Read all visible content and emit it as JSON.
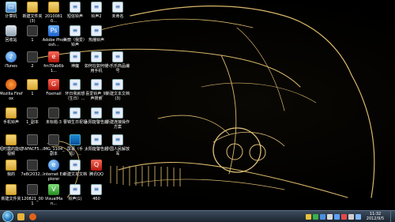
{
  "desktop": {
    "icons": [
      {
        "label": "计算机",
        "glyph": "g-computer",
        "sym": "▭"
      },
      {
        "label": "新建文件夹 (3)",
        "glyph": "g-folder",
        "sym": ""
      },
      {
        "label": "20100810...",
        "glyph": "g-folder",
        "sym": ""
      },
      {
        "label": "短信铃声",
        "glyph": "g-doc",
        "sym": "≡"
      },
      {
        "label": "铃声2",
        "glyph": "g-doc",
        "sym": "≡"
      },
      {
        "label": "未命名",
        "glyph": "g-doc",
        "sym": "≡"
      },
      {
        "label": "回收站",
        "glyph": "g-trash",
        "sym": ""
      },
      {
        "label": "1",
        "glyph": "g-dark",
        "sym": ""
      },
      {
        "label": "Adobe Photosh...",
        "glyph": "g-app",
        "sym": "Ps"
      },
      {
        "label": "美丽（我爱）铃声",
        "glyph": "g-doc",
        "sym": "≡"
      },
      {
        "label": "热播铃声",
        "glyph": "g-doc",
        "sym": "≡"
      },
      {
        "label": "iTunes",
        "glyph": "g-globe",
        "sym": "♪"
      },
      {
        "label": "2",
        "glyph": "g-dark",
        "sym": ""
      },
      {
        "label": "fm70ab6b1...",
        "glyph": "g-red",
        "sym": "e"
      },
      {
        "label": "神魔",
        "glyph": "g-doc",
        "sym": "≡"
      },
      {
        "label": "如何在如何使用手机",
        "glyph": "g-doc",
        "sym": "≡"
      },
      {
        "label": "小乐乐商品编号",
        "glyph": "g-doc",
        "sym": "≡"
      },
      {
        "label": "Mozilla Firefox",
        "glyph": "g-fox",
        "sym": ""
      },
      {
        "label": "1",
        "glyph": "g-folder",
        "sym": ""
      },
      {
        "label": "Foxmail",
        "glyph": "g-red",
        "sym": "G"
      },
      {
        "label": "环日我就想（生日）...",
        "glyph": "g-doc",
        "sym": "≡"
      },
      {
        "label": "喜爱铃声_铃声搜索",
        "glyph": "g-doc",
        "sym": "≡"
      },
      {
        "label": "新建文本文档 (3)",
        "glyph": "g-doc",
        "sym": "≡"
      },
      {
        "label": "手机铃声",
        "glyph": "g-folder",
        "sym": ""
      },
      {
        "label": "1_副本",
        "glyph": "g-dark",
        "sym": ""
      },
      {
        "label": "未标题-3",
        "glyph": "g-dark",
        "sym": ""
      },
      {
        "label": "曹锦生日祝福",
        "glyph": "g-doc",
        "sym": "≡"
      },
      {
        "label": "太阳能警告起",
        "glyph": "g-doc",
        "sym": "≡"
      },
      {
        "label": "新建连接操作方案",
        "glyph": "g-doc",
        "sym": "≡"
      },
      {
        "label": "短时震的能动视频",
        "glyph": "g-folder",
        "sym": ""
      },
      {
        "label": "7AFACF5...",
        "glyph": "g-dark",
        "sym": ""
      },
      {
        "label": "IMG_1104_副本",
        "glyph": "g-dark",
        "sym": ""
      },
      {
        "label": "屏幕（手机）...",
        "glyph": "g-screen",
        "sym": ""
      },
      {
        "label": "太阳能警告起",
        "glyph": "g-doc",
        "sym": "≡"
      },
      {
        "label": "中国人民解放军",
        "glyph": "g-doc",
        "sym": "≡"
      },
      {
        "label": "我的",
        "glyph": "g-folder",
        "sym": ""
      },
      {
        "label": "7e8(2032...",
        "glyph": "g-dark",
        "sym": ""
      },
      {
        "label": "Internet Explorer",
        "glyph": "g-globe",
        "sym": "e"
      },
      {
        "label": "新建文本文档",
        "glyph": "g-doc",
        "sym": "≡"
      },
      {
        "label": "腾讯QQ",
        "glyph": "g-red",
        "sym": "Q"
      },
      {
        "label": "新建文件夹",
        "glyph": "g-folder",
        "sym": ""
      },
      {
        "label": "120821_001",
        "glyph": "g-dark",
        "sym": ""
      },
      {
        "label": "VisualMan...",
        "glyph": "g-green",
        "sym": "V"
      },
      {
        "label": "铃声(1)",
        "glyph": "g-doc",
        "sym": "≡"
      },
      {
        "label": "460",
        "glyph": "g-doc",
        "sym": "≡"
      }
    ]
  },
  "taskbar": {
    "start_label": "开始",
    "pinned": [
      {
        "name": "windows-explorer",
        "color": "#e6b23a"
      },
      {
        "name": "firefox",
        "color": "#e2621b"
      }
    ],
    "tray_colors": [
      "#e8c13a",
      "#3ab04a",
      "#4a8ee0",
      "#d8d8d8",
      "#5aa0ff",
      "#e54848",
      "#cfcfcf",
      "#7fb7ff"
    ],
    "clock_time": "11:32",
    "clock_date": "2012/9/5"
  }
}
